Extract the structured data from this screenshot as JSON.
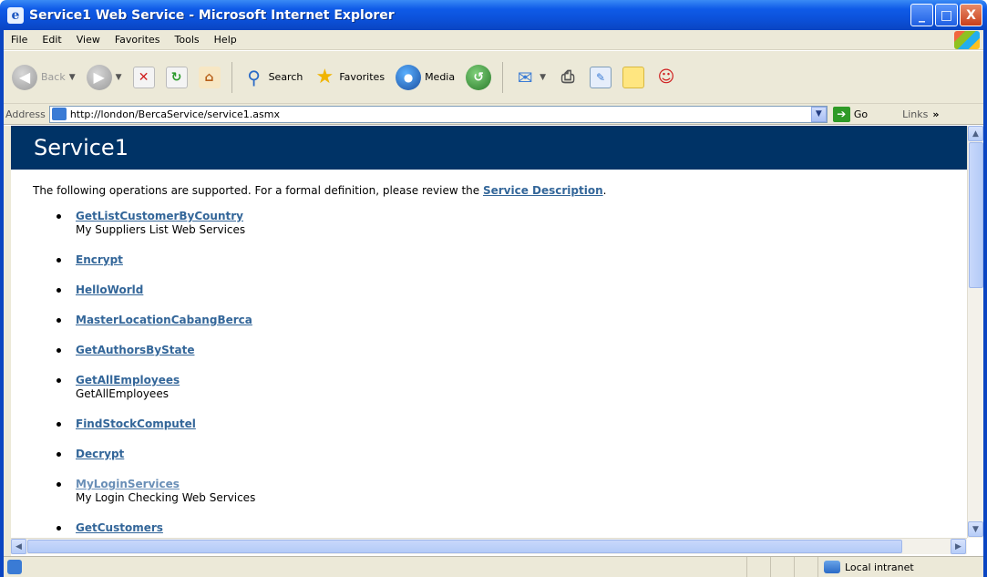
{
  "window": {
    "title": "Service1 Web Service - Microsoft Internet Explorer",
    "controls": {
      "minimize": "_",
      "maximize": "□",
      "close": "X"
    }
  },
  "menu": [
    "File",
    "Edit",
    "View",
    "Favorites",
    "Tools",
    "Help"
  ],
  "toolbar": {
    "back": "Back",
    "search": "Search",
    "favorites": "Favorites",
    "media": "Media"
  },
  "address": {
    "label": "Address",
    "url": "http://london/BercaService/service1.asmx",
    "go": "Go",
    "links": "Links"
  },
  "page": {
    "heading": "Service1",
    "intro_text": "The following operations are supported. For a formal definition, please review the ",
    "intro_link": "Service Description",
    "intro_end": ".",
    "operations": [
      {
        "name": "GetListCustomerByCountry",
        "description": "My Suppliers List Web Services"
      },
      {
        "name": "Encrypt",
        "description": ""
      },
      {
        "name": "HelloWorld",
        "description": ""
      },
      {
        "name": "MasterLocationCabangBerca",
        "description": ""
      },
      {
        "name": "GetAuthorsByState",
        "description": ""
      },
      {
        "name": "GetAllEmployees",
        "description": "GetAllEmployees"
      },
      {
        "name": "FindStockComputel",
        "description": ""
      },
      {
        "name": "Decrypt",
        "description": ""
      },
      {
        "name": "MyLoginServices",
        "description": "My Login Checking Web Services",
        "visited": true
      },
      {
        "name": "GetCustomers",
        "description": ""
      }
    ]
  },
  "status": {
    "zone": "Local intranet"
  },
  "colors": {
    "header_band": "#003366",
    "link": "#336699",
    "visited_link": "#6a8fb7"
  }
}
